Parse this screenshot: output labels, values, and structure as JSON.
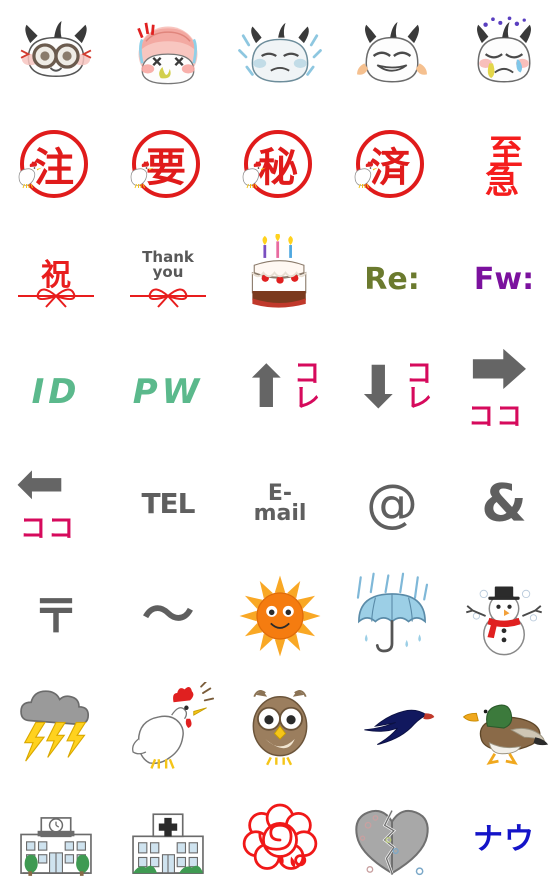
{
  "page": {
    "title": "Emoji sticker sheet",
    "columns": 5,
    "rows": 8,
    "background": "#ffffff"
  },
  "palette": {
    "stamp_red": "#e01b1b",
    "urgent_red": "#f51d1d",
    "koko_magenta": "#d60a5c",
    "gray_text": "#5f5f5f",
    "green_text": "#5bb98c",
    "olive_text": "#6b7a2e",
    "purple_text": "#7b119e",
    "blue_text": "#1414c8",
    "sun_orange": "#f57c10",
    "umbrella_blue": "#8dc6e0",
    "lightning_yellow": "#ffd21e"
  },
  "items": [
    {
      "row": 1,
      "col": 1,
      "name": "face-goggles-surprised",
      "type": "illustration",
      "label": ""
    },
    {
      "row": 1,
      "col": 2,
      "name": "face-angry-pink-hair",
      "type": "illustration",
      "label": ""
    },
    {
      "row": 1,
      "col": 3,
      "name": "face-cold-shivering",
      "type": "illustration",
      "label": ""
    },
    {
      "row": 1,
      "col": 4,
      "name": "face-grin-embarrassed",
      "type": "illustration",
      "label": ""
    },
    {
      "row": 1,
      "col": 5,
      "name": "face-crying-sad",
      "type": "illustration",
      "label": ""
    },
    {
      "row": 2,
      "col": 1,
      "name": "stamp-chuu",
      "type": "hanko",
      "label": "注"
    },
    {
      "row": 2,
      "col": 2,
      "name": "stamp-you",
      "type": "hanko",
      "label": "要"
    },
    {
      "row": 2,
      "col": 3,
      "name": "stamp-maru-hi",
      "type": "hanko",
      "label": "秘"
    },
    {
      "row": 2,
      "col": 4,
      "name": "stamp-sumi",
      "type": "hanko",
      "label": "済"
    },
    {
      "row": 2,
      "col": 5,
      "name": "text-shikyu-urgent",
      "type": "text-jp",
      "label": "至急",
      "label_a": "至",
      "label_b": "急"
    },
    {
      "row": 3,
      "col": 1,
      "name": "noshi-iwai",
      "type": "noshi",
      "label": "祝"
    },
    {
      "row": 3,
      "col": 2,
      "name": "noshi-thank-you",
      "type": "noshi",
      "label": "Thank you",
      "line1": "Thank",
      "line2": "you"
    },
    {
      "row": 3,
      "col": 3,
      "name": "birthday-cake",
      "type": "illustration",
      "label": ""
    },
    {
      "row": 3,
      "col": 4,
      "name": "text-re-reply",
      "type": "text-en",
      "label": "Re:"
    },
    {
      "row": 3,
      "col": 5,
      "name": "text-fw-forward",
      "type": "text-en",
      "label": "Fw:"
    },
    {
      "row": 4,
      "col": 1,
      "name": "text-id",
      "type": "text-en",
      "label": "ID"
    },
    {
      "row": 4,
      "col": 2,
      "name": "text-pw",
      "type": "text-en",
      "label": "PW"
    },
    {
      "row": 4,
      "col": 3,
      "name": "arrow-up-kore",
      "type": "koko",
      "label": "コレ",
      "arrow": "up"
    },
    {
      "row": 4,
      "col": 4,
      "name": "arrow-down-kore",
      "type": "koko",
      "label": "コレ",
      "arrow": "down"
    },
    {
      "row": 4,
      "col": 5,
      "name": "arrow-right-koko",
      "type": "koko",
      "label": "ココ",
      "arrow": "right"
    },
    {
      "row": 5,
      "col": 1,
      "name": "arrow-left-koko",
      "type": "koko",
      "label": "ココ",
      "arrow": "left"
    },
    {
      "row": 5,
      "col": 2,
      "name": "text-tel",
      "type": "text-en",
      "label": "TEL"
    },
    {
      "row": 5,
      "col": 3,
      "name": "text-email",
      "type": "text-en",
      "label": "E-mail",
      "line1": "E-",
      "line2": "mail"
    },
    {
      "row": 5,
      "col": 4,
      "name": "symbol-at-sign",
      "type": "symbol",
      "label": "@"
    },
    {
      "row": 5,
      "col": 5,
      "name": "symbol-ampersand",
      "type": "symbol",
      "label": "&"
    },
    {
      "row": 6,
      "col": 1,
      "name": "symbol-postal-mark",
      "type": "symbol",
      "label": "〒"
    },
    {
      "row": 6,
      "col": 2,
      "name": "symbol-wave-dash",
      "type": "symbol",
      "label": "〜"
    },
    {
      "row": 6,
      "col": 3,
      "name": "weather-sun",
      "type": "illustration",
      "label": ""
    },
    {
      "row": 6,
      "col": 4,
      "name": "weather-umbrella-rain",
      "type": "illustration",
      "label": ""
    },
    {
      "row": 6,
      "col": 5,
      "name": "weather-snowman",
      "type": "illustration",
      "label": ""
    },
    {
      "row": 7,
      "col": 1,
      "name": "weather-thundercloud",
      "type": "illustration",
      "label": ""
    },
    {
      "row": 7,
      "col": 2,
      "name": "bird-rooster-crowing",
      "type": "illustration",
      "label": ""
    },
    {
      "row": 7,
      "col": 3,
      "name": "bird-owl",
      "type": "illustration",
      "label": ""
    },
    {
      "row": 7,
      "col": 4,
      "name": "bird-swallow",
      "type": "illustration",
      "label": ""
    },
    {
      "row": 7,
      "col": 5,
      "name": "bird-duck",
      "type": "illustration",
      "label": ""
    },
    {
      "row": 8,
      "col": 1,
      "name": "building-school",
      "type": "illustration",
      "label": ""
    },
    {
      "row": 8,
      "col": 2,
      "name": "building-hospital",
      "type": "illustration",
      "label": ""
    },
    {
      "row": 8,
      "col": 3,
      "name": "flower-red-carnation",
      "type": "illustration",
      "label": ""
    },
    {
      "row": 8,
      "col": 4,
      "name": "broken-heart-gray",
      "type": "illustration",
      "label": ""
    },
    {
      "row": 8,
      "col": 5,
      "name": "text-nau-now",
      "type": "text-jp",
      "label": "ナウ"
    }
  ]
}
